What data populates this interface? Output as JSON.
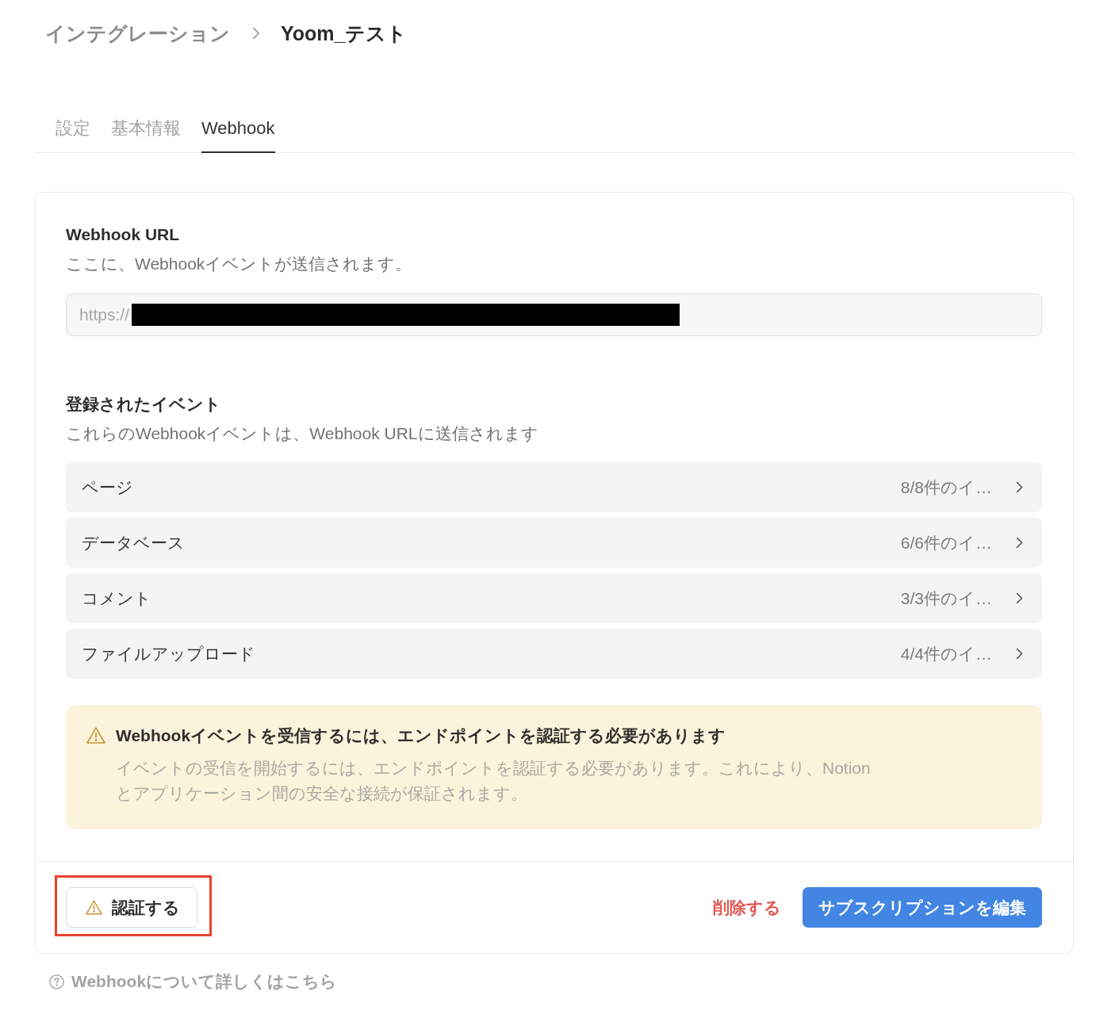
{
  "breadcrumb": {
    "items": [
      {
        "label": "インテグレーション",
        "current": false
      },
      {
        "label": "Yoom_テスト",
        "current": true
      }
    ]
  },
  "tabs": [
    {
      "label": "設定",
      "selected": false
    },
    {
      "label": "基本情報",
      "selected": false
    },
    {
      "label": "Webhook",
      "selected": true
    }
  ],
  "webhook_url": {
    "title": "Webhook URL",
    "description": "ここに、Webhookイベントが送信されます。",
    "value": "https://",
    "redacted": true
  },
  "events": {
    "title": "登録されたイベント",
    "description": "これらのWebhookイベントは、Webhook URLに送信されます",
    "items": [
      {
        "name": "ページ",
        "summary": "8/8件のイ…"
      },
      {
        "name": "データベース",
        "summary": "6/6件のイ…"
      },
      {
        "name": "コメント",
        "summary": "3/3件のイ…"
      },
      {
        "name": "ファイルアップロード",
        "summary": "4/4件のイ…"
      }
    ]
  },
  "warning": {
    "title": "Webhookイベントを受信するには、エンドポイントを認証する必要があります",
    "body": "イベントの受信を開始するには、エンドポイントを認証する必要があります。これにより、Notionとアプリケーション間の安全な接続が保証されます。"
  },
  "actions": {
    "verify": {
      "label": "認証する",
      "highlighted": true
    },
    "delete": {
      "label": "削除する"
    },
    "edit": {
      "label": "サブスクリプションを編集"
    }
  },
  "help_link": {
    "label": "Webhookについて詳しくはこちら"
  }
}
